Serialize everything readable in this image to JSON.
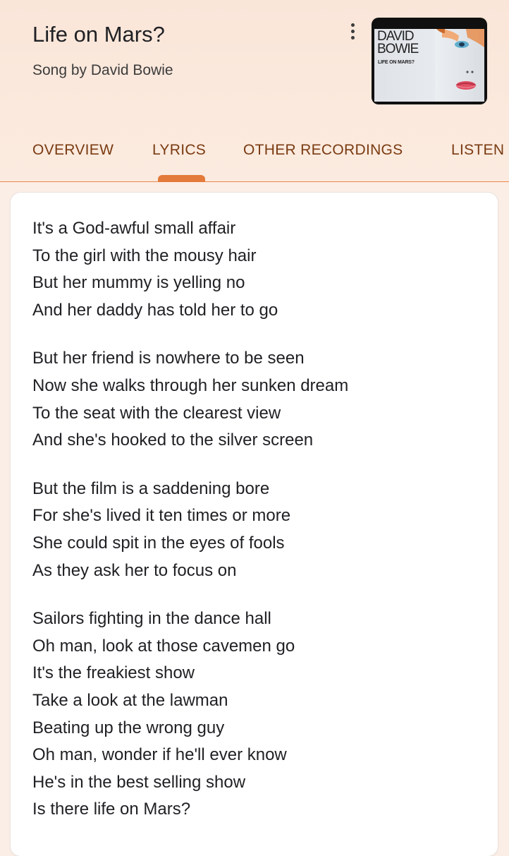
{
  "song": {
    "title": "Life on Mars?",
    "subtitle": "Song by David Bowie",
    "cover_icon": "album-cover-image",
    "cover_text_line1": "DAVID",
    "cover_text_line2": "BOWIE",
    "cover_text_small": "LIFE ON MARS?"
  },
  "tabs": [
    {
      "label": "OVERVIEW",
      "selected": false
    },
    {
      "label": "LYRICS",
      "selected": true
    },
    {
      "label": "OTHER RECORDINGS",
      "selected": false
    },
    {
      "label": "LISTEN",
      "selected": false
    }
  ],
  "colors": {
    "accent": "#e37a3a",
    "tab_text": "#7a3b12",
    "header_bg": "#fae6d9"
  },
  "lyrics": {
    "stanzas": [
      [
        "It's a God-awful small affair",
        "To the girl with the mousy hair",
        "But her mummy is yelling no",
        "And her daddy has told her to go"
      ],
      [
        "But her friend is nowhere to be seen",
        "Now she walks through her sunken dream",
        "To the seat with the clearest view",
        "And she's hooked to the silver screen"
      ],
      [
        "But the film is a saddening bore",
        "For she's lived it ten times or more",
        "She could spit in the eyes of fools",
        "As they ask her to focus on"
      ],
      [
        "Sailors fighting in the dance hall",
        "Oh man, look at those cavemen go",
        "It's the freakiest show",
        "Take a look at the lawman",
        "Beating up the wrong guy",
        "Oh man, wonder if he'll ever know",
        "He's in the best selling show",
        "Is there life on Mars?"
      ]
    ]
  }
}
